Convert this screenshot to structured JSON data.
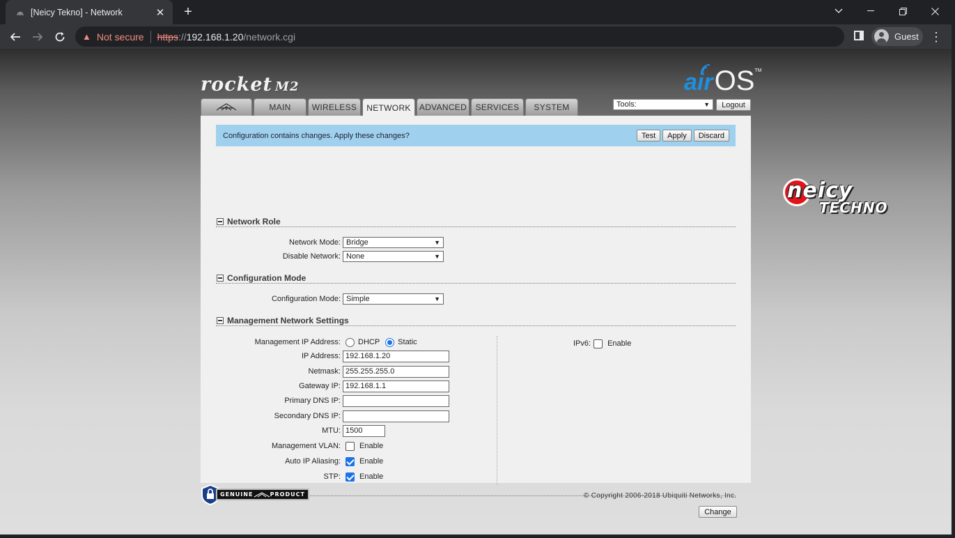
{
  "browser": {
    "tab_title": "[Neicy Tekno] - Network",
    "new_tab_symbol": "+",
    "security_label": "Not secure",
    "url_scheme": "https",
    "url_sep": "://",
    "url_host": "192.168.1.20",
    "url_path": "/network.cgi",
    "profile_name": "Guest"
  },
  "header": {
    "product_logo": "rocket",
    "product_logo_model": "M2",
    "os_logo_air": "air",
    "os_logo_os": "OS",
    "os_logo_tm": "TM",
    "tabs": [
      {
        "label": "MAIN"
      },
      {
        "label": "WIRELESS"
      },
      {
        "label": "NETWORK"
      },
      {
        "label": "ADVANCED"
      },
      {
        "label": "SERVICES"
      },
      {
        "label": "SYSTEM"
      }
    ],
    "active_tab": "NETWORK",
    "tools_value": "Tools:",
    "logout_label": "Logout"
  },
  "banner": {
    "text": "Configuration contains changes. Apply these changes?",
    "test_label": "Test",
    "apply_label": "Apply",
    "discard_label": "Discard"
  },
  "network_role": {
    "title": "Network Role",
    "mode_label": "Network Mode:",
    "mode_value": "Bridge",
    "disable_label": "Disable Network:",
    "disable_value": "None"
  },
  "config_mode": {
    "title": "Configuration Mode",
    "label": "Configuration Mode:",
    "value": "Simple"
  },
  "mgmt": {
    "title": "Management Network Settings",
    "ip_mode_label": "Management IP Address:",
    "dhcp_label": "DHCP",
    "static_label": "Static",
    "ip_mode_selected": "Static",
    "ip_label": "IP Address:",
    "ip_value": "192.168.1.20",
    "netmask_label": "Netmask:",
    "netmask_value": "255.255.255.0",
    "gateway_label": "Gateway IP:",
    "gateway_value": "192.168.1.1",
    "dns1_label": "Primary DNS IP:",
    "dns1_value": "",
    "dns2_label": "Secondary DNS IP:",
    "dns2_value": "",
    "mtu_label": "MTU:",
    "mtu_value": "1500",
    "vlan_label": "Management VLAN:",
    "vlan_enabled": false,
    "alias_label": "Auto IP Aliasing:",
    "alias_enabled": true,
    "stp_label": "STP:",
    "stp_enabled": true,
    "enable_label": "Enable",
    "ipv6_label": "IPv6:",
    "ipv6_enabled": false
  },
  "change_label": "Change",
  "footer": {
    "genuine_left": "GENUINE",
    "genuine_right": "PRODUCT",
    "copyright": "© Copyright 2006-2018 Ubiquiti Networks, Inc."
  },
  "watermark": {
    "line1": "neicy",
    "line2": "TECHNO"
  },
  "colors": {
    "banner": "#9fd1ef",
    "air_blue": "#1d8fe0",
    "check_blue": "#1a73e8",
    "neicy_red": "#e1141b"
  }
}
